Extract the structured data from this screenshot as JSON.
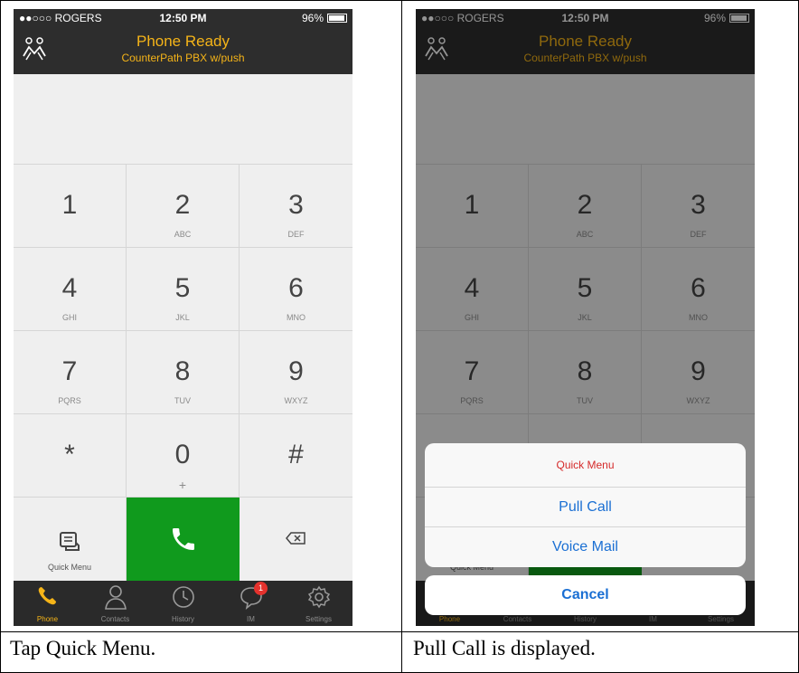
{
  "status": {
    "carrier": "●●○○○ ROGERS",
    "time": "12:50 PM",
    "battery": "96%"
  },
  "header": {
    "title": "Phone Ready",
    "subtitle": "CounterPath PBX w/push"
  },
  "keys": [
    {
      "digit": "1",
      "letters": ""
    },
    {
      "digit": "2",
      "letters": "ABC"
    },
    {
      "digit": "3",
      "letters": "DEF"
    },
    {
      "digit": "4",
      "letters": "GHI"
    },
    {
      "digit": "5",
      "letters": "JKL"
    },
    {
      "digit": "6",
      "letters": "MNO"
    },
    {
      "digit": "7",
      "letters": "PQRS"
    },
    {
      "digit": "8",
      "letters": "TUV"
    },
    {
      "digit": "9",
      "letters": "WXYZ"
    },
    {
      "digit": "*",
      "letters": ""
    },
    {
      "digit": "0",
      "letters": "+"
    },
    {
      "digit": "#",
      "letters": ""
    }
  ],
  "quick_menu_label": "Quick Menu",
  "tabs": [
    {
      "label": "Phone",
      "icon": "phone-icon"
    },
    {
      "label": "Contacts",
      "icon": "contacts-icon"
    },
    {
      "label": "History",
      "icon": "history-icon"
    },
    {
      "label": "IM",
      "icon": "chat-icon",
      "badge": "1"
    },
    {
      "label": "Settings",
      "icon": "gear-icon"
    }
  ],
  "sheet": {
    "title": "Quick Menu",
    "options": [
      "Pull Call",
      "Voice Mail"
    ],
    "cancel": "Cancel"
  },
  "captions": {
    "left": "Tap Quick Menu.",
    "right": "Pull Call is displayed."
  },
  "colors": {
    "accent": "#f5b418",
    "call_green": "#109a1d",
    "link_blue": "#1a6fd3",
    "menu_title_red": "#d52a2a",
    "badge_red": "#e5322d"
  }
}
